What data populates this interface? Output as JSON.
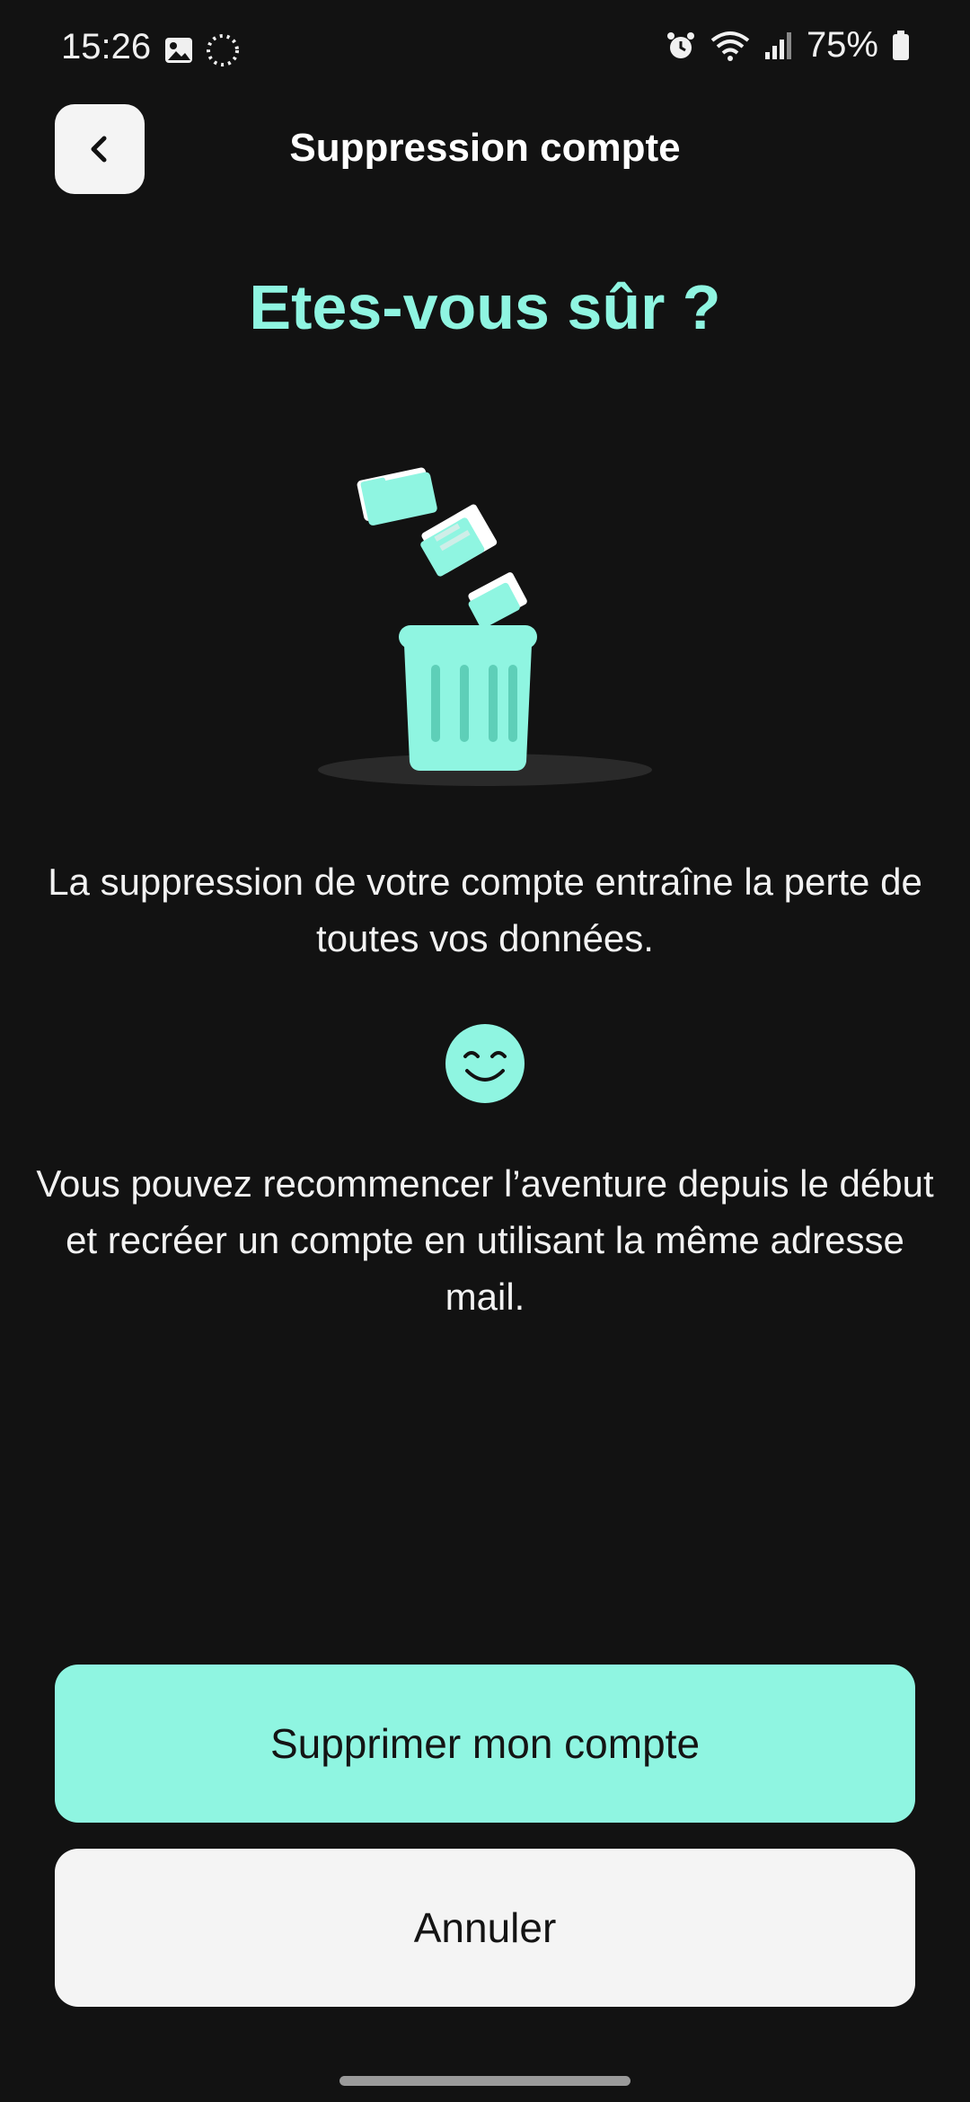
{
  "status_bar": {
    "time": "15:26",
    "battery": "75%",
    "icons": [
      "image-icon",
      "loading-icon",
      "alarm-icon",
      "wifi-icon",
      "signal-icon",
      "battery-icon"
    ]
  },
  "header": {
    "back_icon": "chevron-left-icon",
    "title": "Suppression compte"
  },
  "content": {
    "heading": "Etes-vous sûr ?",
    "illustration": "trash-can-with-falling-files",
    "paragraph_1": "La suppression de votre compte entraîne la perte de toutes vos données.",
    "emoji_icon": "smiley-icon",
    "paragraph_2": "Vous pouvez recommencer l’aventure depuis le début et recréer un compte en utilisant la même adresse mail."
  },
  "actions": {
    "delete_label": "Supprimer mon compte",
    "cancel_label": "Annuler"
  },
  "colors": {
    "background": "#121212",
    "accent": "#8ff5e1",
    "light_button": "#f4f4f4",
    "text": "#ffffff"
  }
}
